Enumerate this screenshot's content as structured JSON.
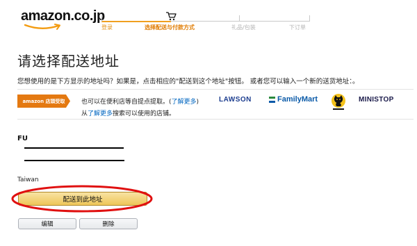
{
  "header": {
    "logo_text": "amazon.co.jp",
    "logo_icon": "amazon-smile-logo"
  },
  "progress": {
    "steps": [
      {
        "label": "登录",
        "state": "done"
      },
      {
        "label": "选择配送与付款方式",
        "state": "current"
      },
      {
        "label": "礼品/包装",
        "state": "todo"
      },
      {
        "label": "下订单",
        "state": "todo"
      }
    ],
    "icon": "cart-icon",
    "active_color": "#f0a020"
  },
  "page": {
    "title": "请选择配送地址",
    "intro": "您想使用的是下方显示的地址吗？如果是，点击相应的\"配送到这个地址\"按钮。 或者您可以输入一个新的送货地址：。"
  },
  "pickup": {
    "badge": "amazon 店頭受取",
    "line1_prefix": "也可以在便利店等自提点提取。(",
    "line1_link": "了解更多",
    "line1_suffix": ")",
    "line2_prefix": "从",
    "line2_link": "了解更多",
    "line2_suffix": "搜索可以使用的店铺。",
    "stores": {
      "lawson": "LAWSON",
      "familymart": "FamilyMart",
      "yamato_icon": "yamato-cat-logo",
      "ministop": "MINISTOP"
    },
    "badge_color": "#e47911",
    "link_color": "#0066c0"
  },
  "address": {
    "name": "FU",
    "country": "Taiwan",
    "ship_button": "配送到此地址",
    "edit_button": "编辑",
    "delete_button": "删除"
  }
}
